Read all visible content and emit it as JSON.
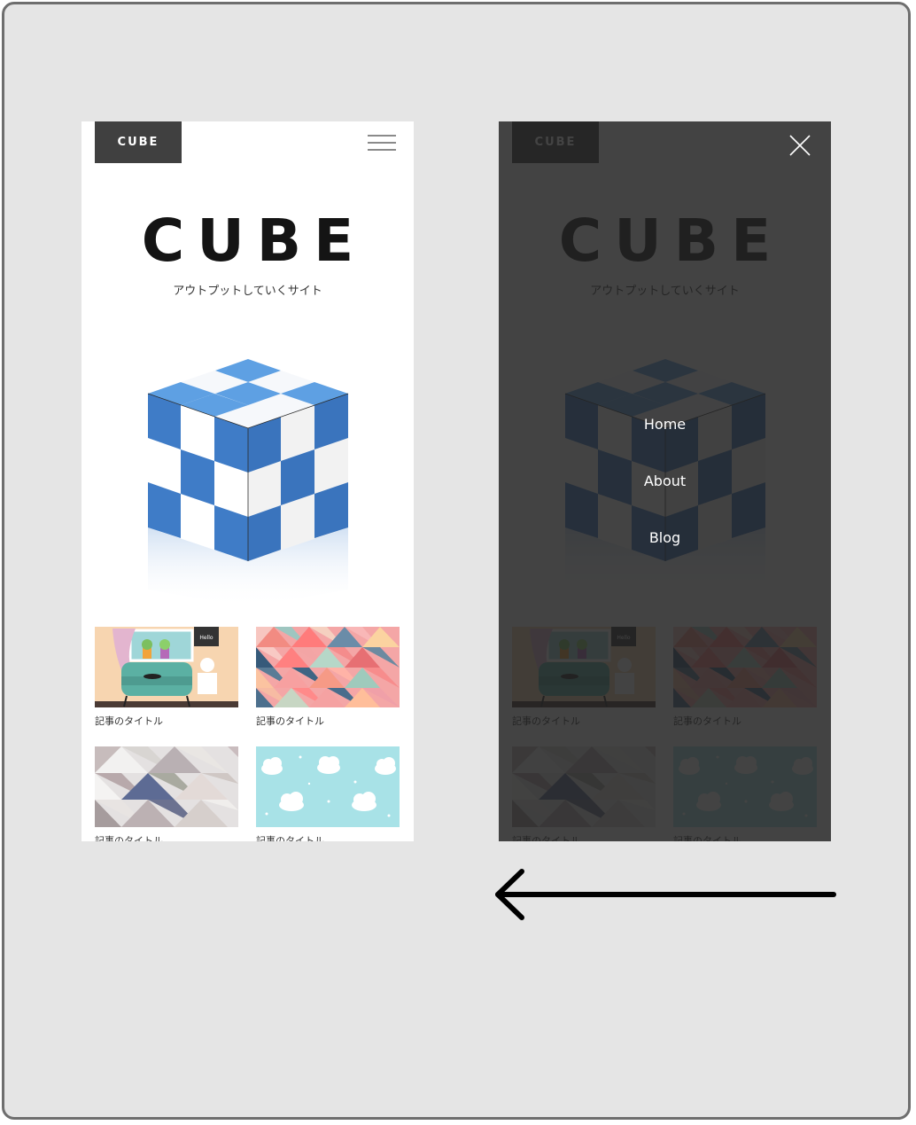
{
  "logo": "CUBE",
  "hero": {
    "title": "CUBE",
    "subtitle": "アウトプットしていくサイト"
  },
  "menu": {
    "items": [
      {
        "label": "Home"
      },
      {
        "label": "About"
      },
      {
        "label": "Blog"
      }
    ]
  },
  "articles": [
    {
      "title": "記事のタイトル",
      "image": "living-room-illustration"
    },
    {
      "title": "記事のタイトル",
      "image": "pink-triangle-pattern"
    },
    {
      "title": "記事のタイトル",
      "image": "gray-triangle-pattern"
    },
    {
      "title": "記事のタイトル",
      "image": "cloud-pattern"
    }
  ],
  "colors": {
    "frame_bg": "#e5e5e5",
    "logo_bg": "#404040",
    "cube_blue": "#4a86cf",
    "overlay": "#222222"
  },
  "icons": {
    "menu": "hamburger-icon",
    "close": "close-icon",
    "arrow": "arrow-left-icon"
  }
}
